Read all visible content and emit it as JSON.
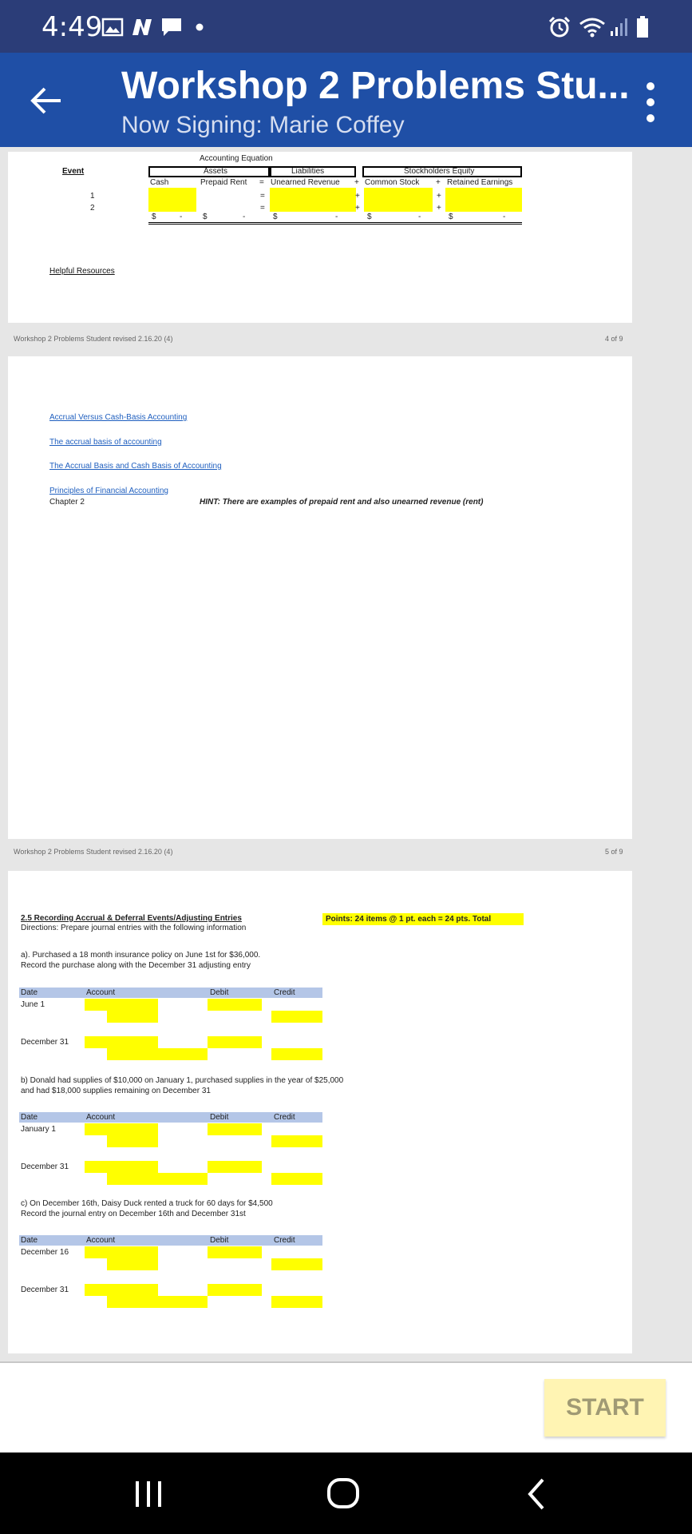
{
  "status_bar": {
    "time": "4:49"
  },
  "app_bar": {
    "title": "Workshop 2 Problems Stu...",
    "subtitle": "Now Signing: Marie Coffey"
  },
  "page4": {
    "header": "Accounting Equation",
    "event_label": "Event",
    "assets_label": "Assets",
    "liabilities_label": "Liabilities",
    "equity_label": "Stockholders Equity",
    "cols": [
      "Cash",
      "Prepaid Rent",
      "Unearned Revenue",
      "Common Stock",
      "Retained Earnings"
    ],
    "ops": [
      "=",
      "+",
      "+"
    ],
    "events": [
      "1",
      "2"
    ],
    "dollar": "$",
    "dash": "-",
    "helpful": "Helpful Resources",
    "footer_left": "Workshop 2 Problems Student revised 2.16.20 (4)",
    "footer_right": "4 of 9"
  },
  "page5": {
    "links": [
      "Accrual Versus Cash-Basis Accounting",
      "The accrual basis of accounting",
      "The Accrual Basis and Cash Basis of Accounting",
      "Principles of Financial Accounting"
    ],
    "chapter": "Chapter 2",
    "hint": "HINT: There are examples of prepaid rent and also unearned revenue (rent)",
    "footer_left": "Workshop 2 Problems Student revised 2.16.20 (4)",
    "footer_right": "5 of 9"
  },
  "page6": {
    "section_title": "2.5 Recording Accrual & Deferral Events/Adjusting Entries",
    "directions": "Directions:  Prepare journal entries with the following information",
    "points": "Points:  24 items @ 1 pt. each = 24 pts. Total",
    "headers": {
      "date": "Date",
      "account": "Account",
      "debit": "Debit",
      "credit": "Credit"
    },
    "problems": [
      {
        "line1": "a). Purchased a 18 month insurance policy on June 1st for $36,000.",
        "line2": "Record the purchase along with the December 31 adjusting entry",
        "d1": "June 1",
        "d2": "December 31"
      },
      {
        "line1": "b) Donald had supplies of $10,000 on January 1, purchased supplies in the year of $25,000",
        "line2": "and had $18,000 supplies remaining on December 31",
        "d1": "January 1",
        "d2": "December 31"
      },
      {
        "line1": "c) On December 16th, Daisy Duck rented a truck for 60 days for $4,500",
        "line2": "Record the journal entry on December 16th and December 31st",
        "d1": "December 16",
        "d2": "December 31"
      }
    ]
  },
  "start_button": "START"
}
